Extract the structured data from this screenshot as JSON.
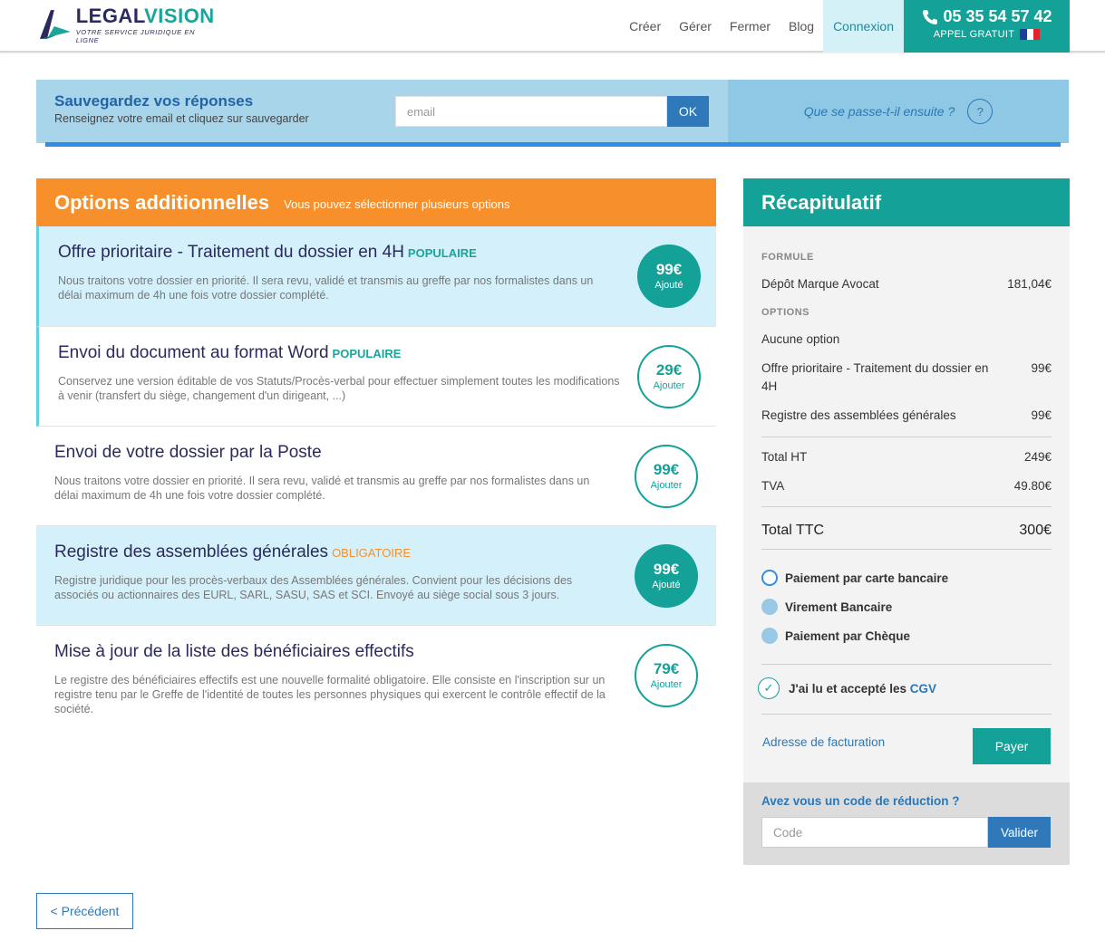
{
  "header": {
    "logo_legal": "LEGAL",
    "logo_vision": "VISION",
    "logo_tagline": "VOTRE SERVICE JURIDIQUE EN LIGNE",
    "nav": [
      "Créer",
      "Gérer",
      "Fermer",
      "Blog",
      "Connexion"
    ],
    "phone": "05 35 54 57 42",
    "phone_sub": "APPEL GRATUIT"
  },
  "savebar": {
    "title": "Sauvegardez vos réponses",
    "subtitle": "Renseignez votre email et cliquez sur sauvegarder",
    "email_placeholder": "email",
    "ok_label": "OK",
    "next_link": "Que se passe-t-il ensuite ?",
    "help_icon_label": "?"
  },
  "options": {
    "title": "Options additionnelles",
    "subtitle": "Vous pouvez sélectionner plusieurs options",
    "items": [
      {
        "title": "Offre prioritaire - Traitement du dossier en 4H",
        "badge": "POPULAIRE",
        "desc": "Nous traitons votre dossier en priorité. Il sera revu, validé et transmis au greffe par nos formalistes dans un délai maximum de 4h une fois votre dossier complété.",
        "price": "99€",
        "status": "Ajouté"
      },
      {
        "title": "Envoi du document au format Word",
        "badge": "POPULAIRE",
        "desc": "Conservez une version éditable de vos Statuts/Procès-verbal pour effectuer simplement toutes les modifications à venir (transfert du siège, changement d'un dirigeant, ...)",
        "price": "29€",
        "status": "Ajouter"
      },
      {
        "title": "Envoi de votre dossier par la Poste",
        "badge": "",
        "desc": "Nous traitons votre dossier en priorité. Il sera revu, validé et transmis au greffe par nos formalistes dans un délai maximum de 4h une fois votre dossier complété.",
        "price": "99€",
        "status": "Ajouter"
      },
      {
        "title": "Registre des assemblées générales",
        "badge": "OBLIGATOIRE",
        "desc": "Registre juridique pour les procès-verbaux des Assemblées générales. Convient pour les décisions des associés ou actionnaires des EURL, SARL, SASU, SAS et SCI. Envoyé au siège social sous 3 jours.",
        "price": "99€",
        "status": "Ajouté"
      },
      {
        "title": "Mise à jour de la liste des bénéficiaires effectifs",
        "badge": "",
        "desc": "Le registre des bénéficiaires effectifs est une nouvelle formalité obligatoire. Elle consiste en l'inscription sur un registre tenu par le Greffe de l'identité de toutes les personnes physiques qui exercent le contrôle effectif de la société.",
        "price": "79€",
        "status": "Ajouter"
      }
    ]
  },
  "recap": {
    "title": "Récapitulatif",
    "formule_label": "FORMULE",
    "formule_name": "Dépôt Marque Avocat",
    "formule_price": "181,04€",
    "options_label": "OPTIONS",
    "no_option": "Aucune option",
    "opt1_name": "Offre prioritaire - Traitement du dossier en 4H",
    "opt1_price": "99€",
    "opt2_name": "Registre des assemblées générales",
    "opt2_price": "99€",
    "total_ht_label": "Total HT",
    "total_ht": "249€",
    "tva_label": "TVA",
    "tva": "49.80€",
    "total_ttc_label": "Total TTC",
    "total_ttc": "300€",
    "payment_card": "Paiement par carte bancaire",
    "payment_transfer": "Virement Bancaire",
    "payment_check": "Paiement par Chèque",
    "cgv_text": "J'ai lu et accepté les",
    "cgv_link": "CGV",
    "billing_link": "Adresse de facturation",
    "pay_label": "Payer"
  },
  "promo": {
    "title": "Avez vous un code de réduction ?",
    "placeholder": "Code",
    "button": "Valider"
  },
  "footer": {
    "prev_label": "< Précédent"
  },
  "colors": {
    "teal": "#14a198",
    "orange": "#f7902a",
    "navy": "#2b2a5e",
    "blue": "#2f79bb",
    "light_blue": "#d4f1fb"
  }
}
